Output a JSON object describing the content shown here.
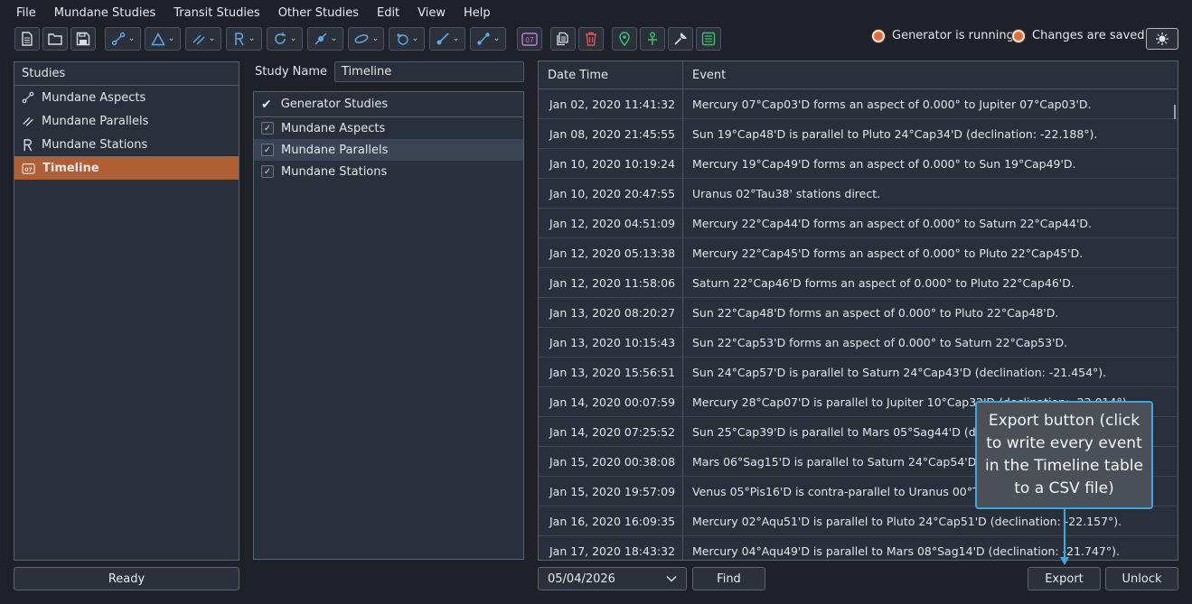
{
  "menu": [
    "File",
    "Mundane Studies",
    "Transit Studies",
    "Other Studies",
    "Edit",
    "View",
    "Help"
  ],
  "toolbar": {
    "buttons": [
      {
        "name": "new-file-icon"
      },
      {
        "name": "open-folder-icon"
      },
      {
        "name": "save-icon"
      },
      {
        "name": "aspect-icon"
      },
      {
        "name": "triangle-icon"
      },
      {
        "name": "parallel-icon"
      },
      {
        "name": "retrograde-icon"
      },
      {
        "name": "cycle-icon"
      },
      {
        "name": "eclipse-icon"
      },
      {
        "name": "link-icon"
      },
      {
        "name": "moon-icon"
      },
      {
        "name": "transit-icon"
      },
      {
        "name": "progression-icon"
      },
      {
        "name": "calendar-icon"
      },
      {
        "name": "copy-icon"
      },
      {
        "name": "trash-icon"
      },
      {
        "name": "location-pin-icon"
      },
      {
        "name": "person-icon"
      },
      {
        "name": "wrench-icon"
      },
      {
        "name": "database-icon"
      },
      {
        "name": "settings-sun-icon"
      }
    ],
    "calendar_badge": "07"
  },
  "status": {
    "generator": "Generator is running",
    "saved": "Changes are saved"
  },
  "colors": {
    "accent": "#b05e33",
    "status_dot": "#e36d3a",
    "callout_border": "#3fa6e0"
  },
  "studies": {
    "header": "Studies",
    "items": [
      {
        "label": "Mundane Aspects",
        "icon": "aspect-icon"
      },
      {
        "label": "Mundane Parallels",
        "icon": "parallel-icon"
      },
      {
        "label": "Mundane Stations",
        "icon": "retrograde-icon"
      },
      {
        "label": "Timeline",
        "icon": "calendar-icon",
        "selected": true
      }
    ],
    "status": "Ready"
  },
  "study": {
    "name_label": "Study Name",
    "name_value": "Timeline",
    "generator_header": "Generator Studies",
    "generator_items": [
      {
        "label": "Mundane Aspects",
        "checked": true
      },
      {
        "label": "Mundane Parallels",
        "checked": true
      },
      {
        "label": "Mundane Stations",
        "checked": true
      }
    ]
  },
  "table": {
    "headers": [
      "Date Time",
      "Event"
    ],
    "rows": [
      [
        "Jan 02, 2020 11:41:32",
        "Mercury 07°Cap03'D forms an aspect of 0.000° to Jupiter 07°Cap03'D."
      ],
      [
        "Jan 08, 2020 21:45:55",
        "Sun 19°Cap48'D is parallel to Pluto 24°Cap34'D (declination: -22.188°)."
      ],
      [
        "Jan 10, 2020 10:19:24",
        "Mercury 19°Cap49'D forms an aspect of 0.000° to Sun 19°Cap49'D."
      ],
      [
        "Jan 10, 2020 20:47:55",
        "Uranus 02°Tau38' stations direct."
      ],
      [
        "Jan 12, 2020 04:51:09",
        "Mercury 22°Cap44'D forms an aspect of 0.000° to Saturn 22°Cap44'D."
      ],
      [
        "Jan 12, 2020 05:13:38",
        "Mercury 22°Cap45'D forms an aspect of 0.000° to Pluto 22°Cap45'D."
      ],
      [
        "Jan 12, 2020 11:58:06",
        "Saturn 22°Cap46'D forms an aspect of 0.000° to Pluto 22°Cap46'D."
      ],
      [
        "Jan 13, 2020 08:20:27",
        "Sun 22°Cap48'D forms an aspect of 0.000° to Pluto 22°Cap48'D."
      ],
      [
        "Jan 13, 2020 10:15:43",
        "Sun 22°Cap53'D forms an aspect of 0.000° to Saturn 22°Cap53'D."
      ],
      [
        "Jan 13, 2020 15:56:51",
        "Sun 24°Cap57'D is parallel to Saturn 24°Cap43'D (declination: -21.454°)."
      ],
      [
        "Jan 14, 2020 00:07:59",
        "Mercury 28°Cap07'D is parallel to Jupiter 10°Cap32'D (declination: -23.014°)."
      ],
      [
        "Jan 14, 2020 07:25:52",
        "Sun 25°Cap39'D is parallel to Mars 05°Sag44'D (declina"
      ],
      [
        "Jan 15, 2020 00:38:08",
        "Mars 06°Sag15'D is parallel to Saturn 24°Cap54'D (decl"
      ],
      [
        "Jan 15, 2020 19:57:09",
        "Venus 05°Pis16'D is contra-parallel to Uranus 00°Tau37"
      ],
      [
        "Jan 16, 2020 16:09:35",
        "Mercury 02°Aqu51'D is parallel to Pluto 24°Cap51'D (declination: -22.157°)."
      ],
      [
        "Jan 17, 2020 18:43:32",
        "Mercury 04°Aqu49'D is parallel to Mars 08°Sag14'D (declination: -21.747°)."
      ]
    ]
  },
  "bottom": {
    "date_value": "05/04/2026",
    "find_label": "Find",
    "export_label": "Export",
    "unlock_label": "Unlock"
  },
  "callout": {
    "text": "Export button (click to write every event in the Timeline table to a CSV file)"
  }
}
